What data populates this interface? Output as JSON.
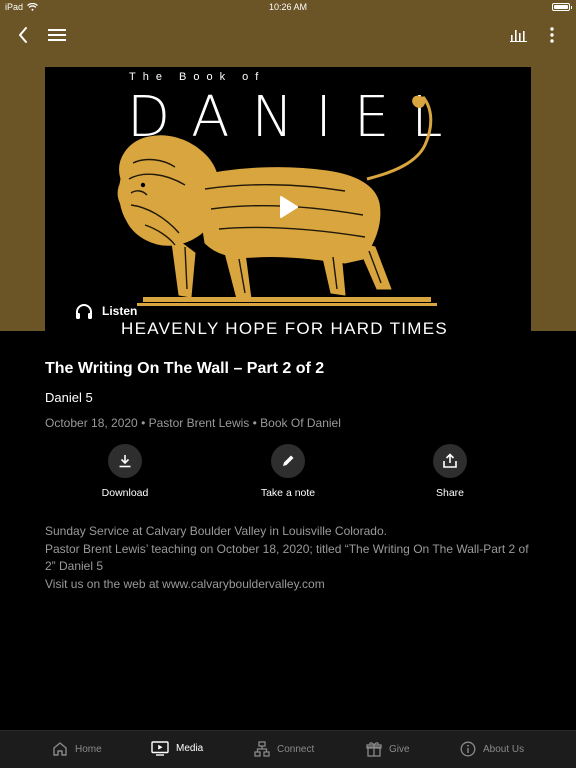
{
  "status_bar": {
    "device": "iPad",
    "time": "10:26 AM",
    "wifi_icon": "wifi-icon",
    "battery_icon": "battery-icon"
  },
  "nav": {
    "back_icon": "chevron-left-icon",
    "menu_icon": "hamburger-menu-icon",
    "audio_icon": "audio-levels-icon",
    "more_icon": "more-vertical-icon"
  },
  "artwork": {
    "kicker": "The Book of",
    "title": "DANIEL",
    "subtitle": "HEAVENLY HOPE FOR HARD TIMES",
    "play_icon": "play-icon",
    "listen_label": "Listen",
    "listen_icon": "headphones-icon",
    "lion_icon": "lion-illustration"
  },
  "sermon": {
    "title": "The Writing On The Wall – Part 2 of 2",
    "scripture": "Daniel 5",
    "meta": "October 18, 2020 • Pastor Brent Lewis • Book Of Daniel"
  },
  "actions": [
    {
      "label": "Download",
      "icon": "download-icon"
    },
    {
      "label": "Take a note",
      "icon": "pencil-icon"
    },
    {
      "label": "Share",
      "icon": "share-icon"
    }
  ],
  "description": {
    "line1": "Sunday Service at Calvary Boulder Valley in Louisville Colorado.",
    "line2": "Pastor Brent Lewis’ teaching on October 18, 2020; titled “The Writing On The Wall-Part 2 of 2”  Daniel 5",
    "line3": "Visit us on the web at www.calvarybouldervalley.com"
  },
  "tabs": [
    {
      "label": "Home",
      "icon": "home-icon",
      "active": false
    },
    {
      "label": "Media",
      "icon": "tv-play-icon",
      "active": true
    },
    {
      "label": "Connect",
      "icon": "connect-icon",
      "active": false
    },
    {
      "label": "Give",
      "icon": "gift-icon",
      "active": false
    },
    {
      "label": "About Us",
      "icon": "info-icon",
      "active": false
    }
  ],
  "colors": {
    "header_bg": "#6b5426",
    "accent_gold": "#d9a53f",
    "background": "#000000",
    "muted_text": "#9a9a9a",
    "tabbar_bg": "#1c1c1c"
  }
}
